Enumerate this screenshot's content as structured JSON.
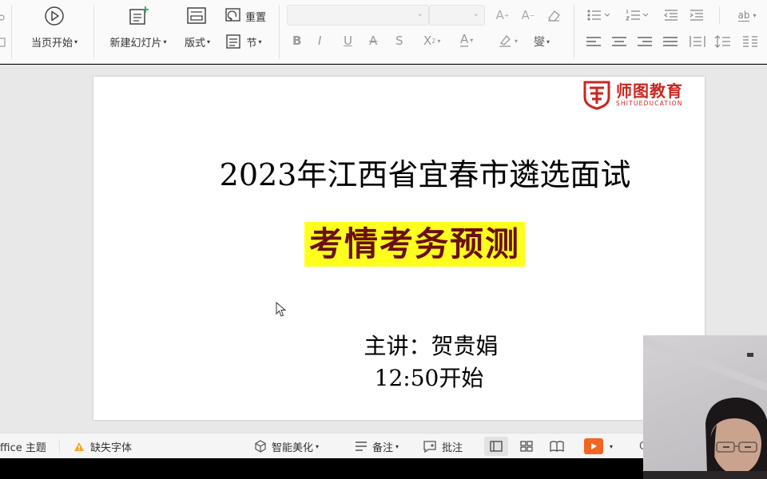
{
  "ribbon": {
    "play_label": "当页开始",
    "new_slide_label": "新建幻灯片",
    "layout_label": "版式",
    "reset_label": "重置",
    "section_label": "节"
  },
  "slide": {
    "logo_cn": "师图教育",
    "logo_en": "SHITUEDUCATION",
    "title": "2023年江西省宜春市遴选面试",
    "subtitle": "考情考务预测",
    "presenter": "主讲：贺贵娟",
    "start_time": "12:50开始"
  },
  "statusbar": {
    "theme": "ffice 主题",
    "missing_font": "缺失字体",
    "smart_beautify": "智能美化",
    "notes": "备注",
    "comments": "批注"
  },
  "colors": {
    "logo_red": "#c9261f",
    "highlight_yellow": "#ffff1e",
    "play_orange": "#f26522"
  }
}
